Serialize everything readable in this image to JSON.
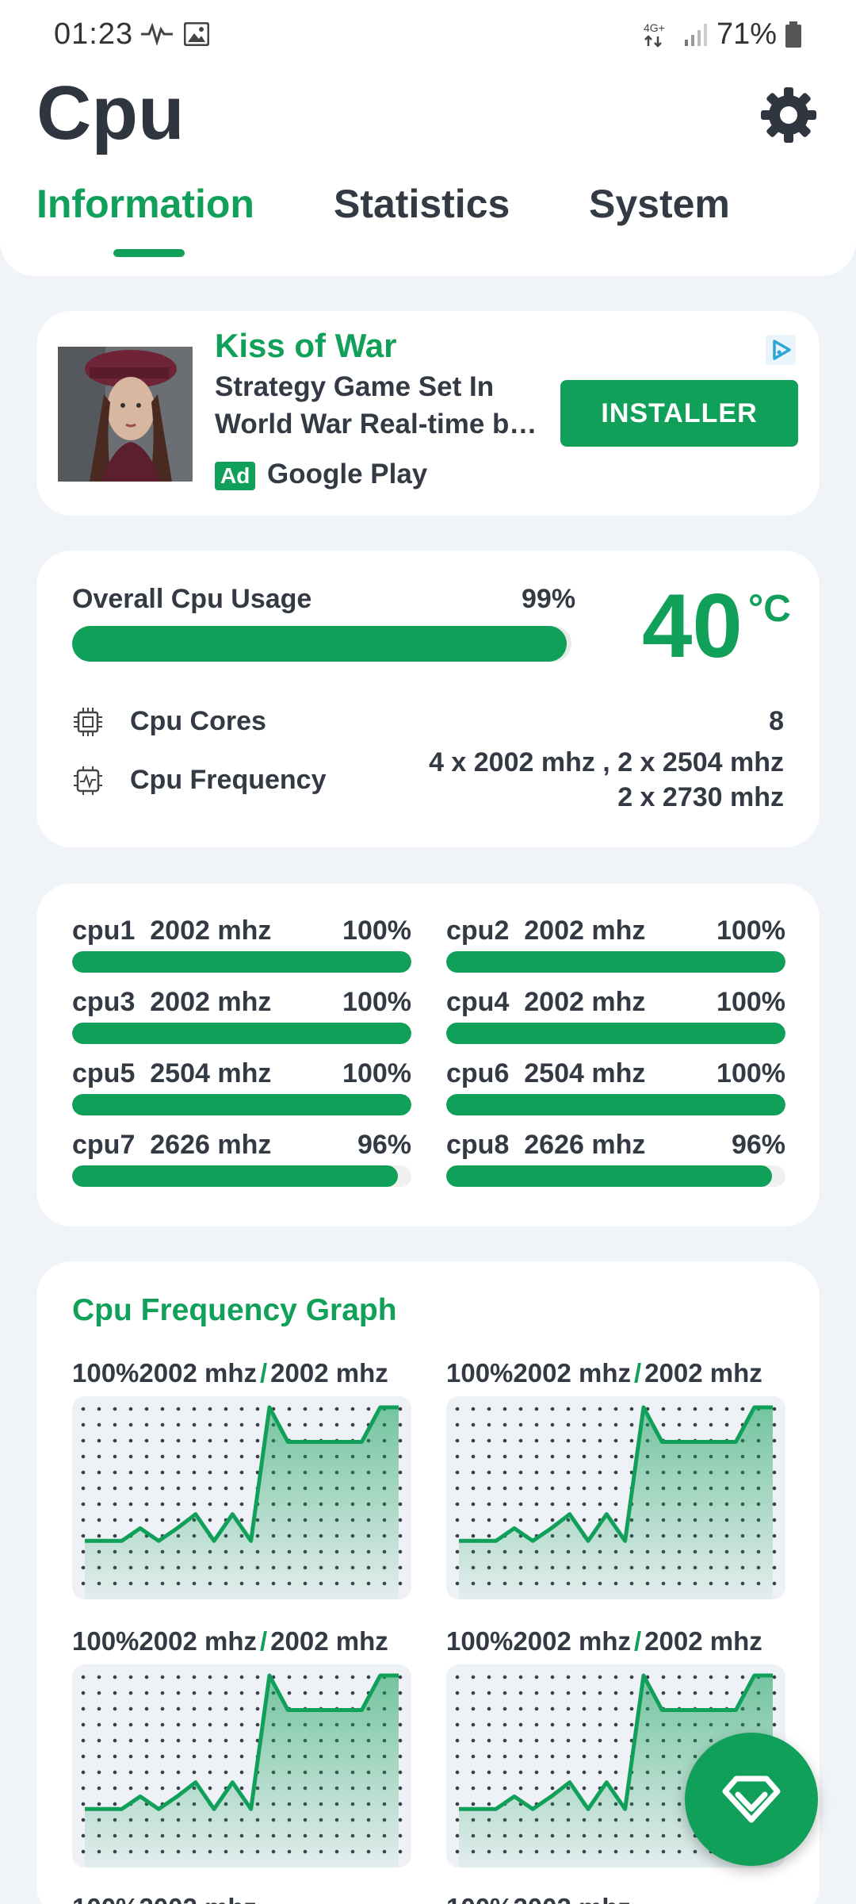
{
  "status_bar": {
    "time": "01:23",
    "battery": "71%",
    "network": "4G+"
  },
  "app": {
    "title": "Cpu"
  },
  "tabs": [
    {
      "label": "Information",
      "active": true
    },
    {
      "label": "Statistics",
      "active": false
    },
    {
      "label": "System",
      "active": false
    }
  ],
  "ad": {
    "name": "Kiss of War",
    "description": "Strategy Game Set In World War Real-time b…",
    "badge": "Ad",
    "store": "Google Play",
    "button": "INSTALLER"
  },
  "usage": {
    "label": "Overall Cpu Usage",
    "percent_text": "99%",
    "percent": 99,
    "temperature": "40",
    "temperature_unit": "°C",
    "cores_label": "Cpu Cores",
    "cores_value": "8",
    "frequency_label": "Cpu Frequency",
    "frequency_line1": "4 x 2002 mhz , 2 x 2504 mhz",
    "frequency_line2": "2 x 2730 mhz"
  },
  "cores": [
    {
      "name": "cpu1  2002 mhz",
      "percent_text": "100%",
      "percent": 100
    },
    {
      "name": "cpu2  2002 mhz",
      "percent_text": "100%",
      "percent": 100
    },
    {
      "name": "cpu3  2002 mhz",
      "percent_text": "100%",
      "percent": 100
    },
    {
      "name": "cpu4  2002 mhz",
      "percent_text": "100%",
      "percent": 100
    },
    {
      "name": "cpu5  2504 mhz",
      "percent_text": "100%",
      "percent": 100
    },
    {
      "name": "cpu6  2504 mhz",
      "percent_text": "100%",
      "percent": 100
    },
    {
      "name": "cpu7  2626 mhz",
      "percent_text": "96%",
      "percent": 96
    },
    {
      "name": "cpu8  2626 mhz",
      "percent_text": "96%",
      "percent": 96
    }
  ],
  "graph": {
    "title": "Cpu Frequency Graph",
    "cells": [
      {
        "left": "100%2002 mhz",
        "sep": "/",
        "right": "2002 mhz"
      },
      {
        "left": "100%2002 mhz",
        "sep": "/",
        "right": "2002 mhz"
      },
      {
        "left": "100%2002 mhz",
        "sep": "/",
        "right": "2002 mhz"
      },
      {
        "left": "100%2002 mhz",
        "sep": "/",
        "right": "2002 mhz"
      }
    ],
    "series": [
      0.15,
      0.15,
      0.15,
      0.23,
      0.15,
      0.23,
      0.32,
      0.15,
      0.32,
      0.15,
      1.0,
      0.78,
      0.78,
      0.78,
      0.78,
      0.78,
      1.0,
      1.0
    ],
    "line_color": "#11a05a"
  },
  "theme": {
    "accent": "#11a05a",
    "background": "#f0f3f8",
    "text": "#333a44"
  }
}
